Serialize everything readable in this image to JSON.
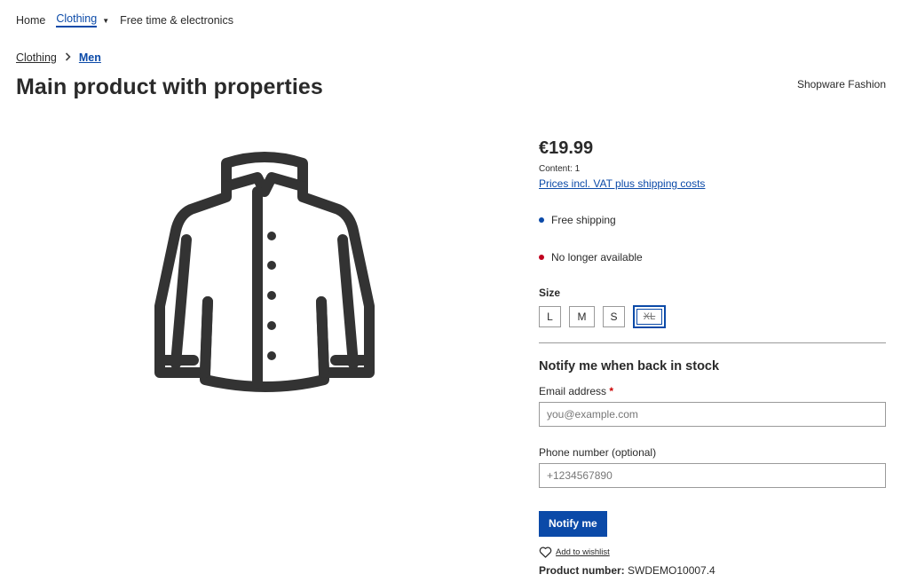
{
  "nav": {
    "home": "Home",
    "clothing": "Clothing",
    "free_time": "Free time & electronics"
  },
  "breadcrumb": {
    "items": [
      "Clothing",
      "Men"
    ]
  },
  "product": {
    "title": "Main product with properties",
    "manufacturer": "Shopware Fashion",
    "image_icon": "shirt-icon"
  },
  "buybox": {
    "price": "€19.99",
    "content": "Content: 1",
    "vat_link": "Prices incl. VAT plus shipping costs",
    "free_shipping": "Free shipping",
    "availability": "No longer available",
    "colors": {
      "shipping_dot": "#0b4aa8",
      "availability_dot": "#c0001e",
      "accent": "#0b4aa8"
    }
  },
  "size": {
    "label": "Size",
    "options": [
      "L",
      "M",
      "S",
      "XL"
    ],
    "selected": "XL"
  },
  "notify": {
    "title": "Notify me when back in stock",
    "email_label": "Email address",
    "email_required": "*",
    "email_placeholder": "you@example.com",
    "phone_label": "Phone number (optional)",
    "phone_placeholder": "+1234567890",
    "button": "Notify me"
  },
  "wishlist": {
    "label": "Add to wishlist"
  },
  "product_number": {
    "label": "Product number:",
    "value": "SWDEMO10007.4"
  }
}
